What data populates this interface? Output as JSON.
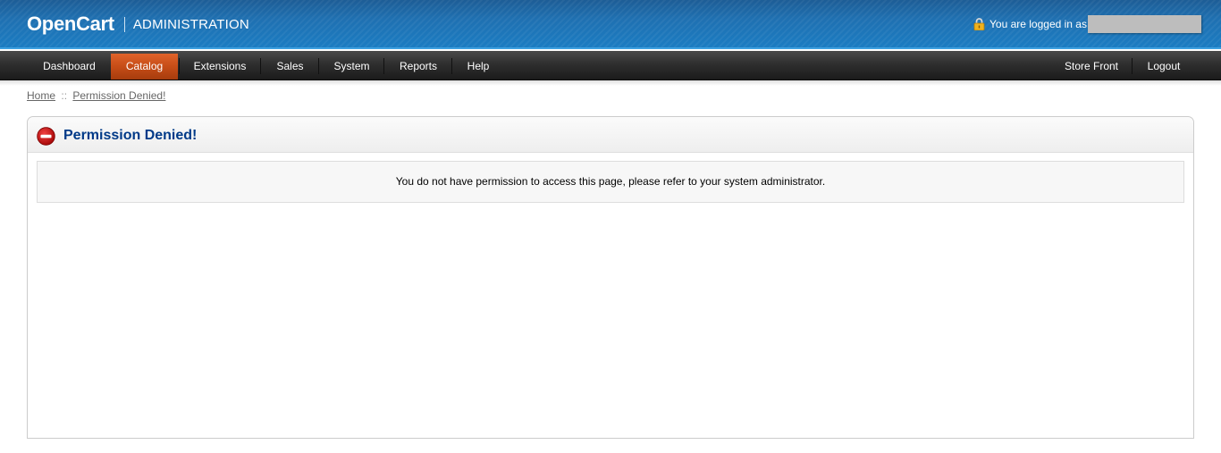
{
  "header": {
    "brand": "OpenCart",
    "subtitle": "ADMINISTRATION",
    "logged_in_text": "You are logged in as",
    "lock_icon": "lock-icon"
  },
  "menu": {
    "left": [
      {
        "label": "Dashboard",
        "active": false
      },
      {
        "label": "Catalog",
        "active": true
      },
      {
        "label": "Extensions",
        "active": false
      },
      {
        "label": "Sales",
        "active": false
      },
      {
        "label": "System",
        "active": false
      },
      {
        "label": "Reports",
        "active": false
      },
      {
        "label": "Help",
        "active": false
      }
    ],
    "right": [
      {
        "label": "Store Front"
      },
      {
        "label": "Logout"
      }
    ]
  },
  "breadcrumb": {
    "items": [
      "Home",
      "Permission Denied!"
    ],
    "separator": "::"
  },
  "box": {
    "title": "Permission Denied!",
    "title_icon": "stop-icon",
    "message": "You do not have permission to access this page, please refer to your system administrator."
  },
  "colors": {
    "header_blue": "#1f72b4",
    "menu_dark": "#2f2f2f",
    "active_orange": "#c64d17",
    "title_blue": "#003a88",
    "stop_red": "#cc1111"
  }
}
